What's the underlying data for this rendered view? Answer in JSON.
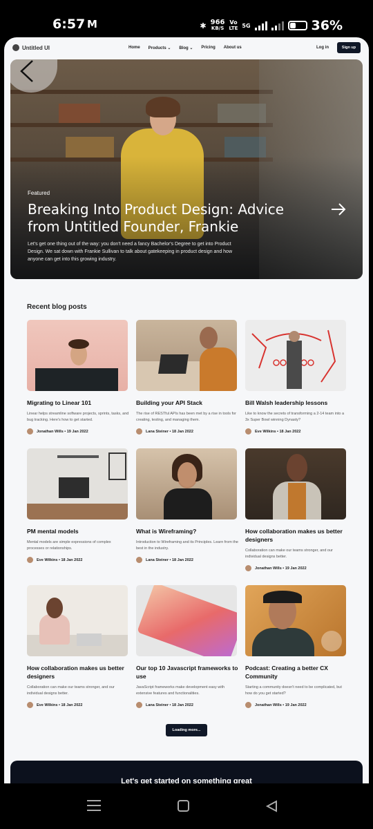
{
  "status": {
    "time": "6:57",
    "app_glyph": "M",
    "network_speed_top": "966",
    "network_speed_bottom": "KB/S",
    "volte_top": "Vo",
    "volte_bottom": "LTE",
    "fiveg": "5G",
    "battery": "36%"
  },
  "site_nav": {
    "logo": "Untitled UI",
    "links": [
      "Home",
      "Products ⌄",
      "Blog ⌄",
      "Pricing",
      "About us"
    ],
    "login": "Log in",
    "signup": "Sign up"
  },
  "hero": {
    "featured": "Featured",
    "title": "Breaking Into Product Design: Advice from Untitled Founder, Frankie",
    "description": "Let's get one thing out of the way: you don't need a fancy Bachelor's Degree to get into Product Design. We sat down with Frankie Sullivan to talk about gatekeeping in product design and how anyone can get into this growing industry."
  },
  "recent": {
    "heading": "Recent blog posts",
    "posts": [
      {
        "title": "Migrating to Linear 101",
        "desc": "Linear helps streamline software projects, sprints, tasks, and bug tracking. Here's how to get started.",
        "meta": "Jonathan Wills • 19 Jan 2022"
      },
      {
        "title": "Building your API Stack",
        "desc": "The rise of RESTful APIs has been met by a rise in tools for creating, testing, and managing them.",
        "meta": "Lana Steiner • 18 Jan 2022"
      },
      {
        "title": "Bill Walsh leadership lessons",
        "desc": "Like to know the secrets of transforming a 2-14 team into a 3x Super Bowl winning Dynasty?",
        "meta": "Eve Wilkins • 18 Jan 2022"
      },
      {
        "title": "PM mental models",
        "desc": "Mental models are simple expressions of complex processes or relationships.",
        "meta": "Eve Wilkins • 18 Jan 2022"
      },
      {
        "title": "What is Wireframing?",
        "desc": "Introduction to Wireframing and its Principles. Learn from the best in the industry.",
        "meta": "Lana Steiner • 18 Jan 2022"
      },
      {
        "title": "How collaboration makes us better designers",
        "desc": "Collaboration can make our teams stronger, and our individual designs better.",
        "meta": "Jonathan Wills • 19 Jan 2022"
      },
      {
        "title": "How collaboration makes us better designers",
        "desc": "Collaboration can make our teams stronger, and our individual designs better.",
        "meta": "Eve Wilkins • 18 Jan 2022"
      },
      {
        "title": "Our top 10 Javascript frameworks to use",
        "desc": "JavaScript frameworks make development easy with extensive features and functionalities.",
        "meta": "Lana Steiner • 18 Jan 2022"
      },
      {
        "title": "Podcast: Creating a better CX Community",
        "desc": "Starting a community doesn't need to be complicated, but how do you get started?",
        "meta": "Jonathan Wills • 19 Jan 2022"
      }
    ],
    "load_more": "Loading more..."
  },
  "cta": {
    "title": "Let's get started on something great"
  },
  "colors": {
    "dark": "#101828",
    "page_bg": "#f6f7f9"
  }
}
